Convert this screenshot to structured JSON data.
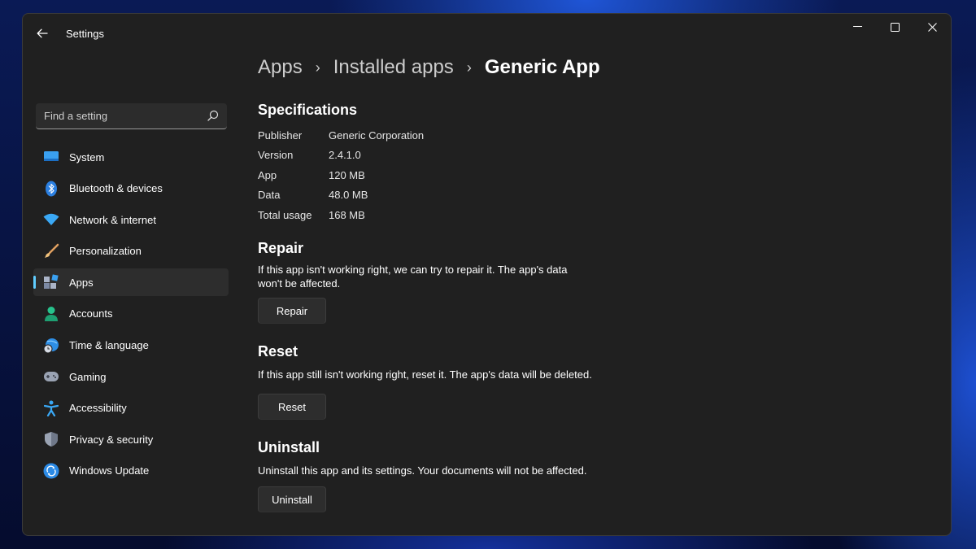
{
  "window": {
    "title": "Settings",
    "controls": {
      "minimize": "minimize-icon",
      "maximize": "maximize-icon",
      "close": "close-icon"
    }
  },
  "search": {
    "placeholder": "Find a setting",
    "icon": "search-icon"
  },
  "sidebar": {
    "items": [
      {
        "label": "System",
        "icon": "monitor-icon",
        "active": false
      },
      {
        "label": "Bluetooth & devices",
        "icon": "bluetooth-icon",
        "active": false
      },
      {
        "label": "Network & internet",
        "icon": "wifi-icon",
        "active": false
      },
      {
        "label": "Personalization",
        "icon": "brush-icon",
        "active": false
      },
      {
        "label": "Apps",
        "icon": "apps-icon",
        "active": true
      },
      {
        "label": "Accounts",
        "icon": "person-icon",
        "active": false
      },
      {
        "label": "Time & language",
        "icon": "globe-clock-icon",
        "active": false
      },
      {
        "label": "Gaming",
        "icon": "gamepad-icon",
        "active": false
      },
      {
        "label": "Accessibility",
        "icon": "accessibility-icon",
        "active": false
      },
      {
        "label": "Privacy & security",
        "icon": "shield-icon",
        "active": false
      },
      {
        "label": "Windows Update",
        "icon": "update-icon",
        "active": false
      }
    ]
  },
  "breadcrumb": [
    "Apps",
    "Installed apps",
    "Generic App"
  ],
  "specifications": {
    "title": "Specifications",
    "rows": [
      {
        "key": "Publisher",
        "value": "Generic Corporation"
      },
      {
        "key": "Version",
        "value": "2.4.1.0"
      },
      {
        "key": "App",
        "value": "120 MB"
      },
      {
        "key": "Data",
        "value": "48.0 MB"
      },
      {
        "key": "Total usage",
        "value": "168 MB"
      }
    ]
  },
  "repair": {
    "title": "Repair",
    "description": "If this app isn't working right, we can try to repair it. The app's data won't be affected.",
    "button": "Repair"
  },
  "reset": {
    "title": "Reset",
    "description": "If this app still isn't working right, reset it. The app's data will be deleted.",
    "button": "Reset"
  },
  "uninstall": {
    "title": "Uninstall",
    "description": "Uninstall this app and its settings. Your documents will not be affected.",
    "button": "Uninstall"
  },
  "colors": {
    "accent": "#60cdff",
    "window_bg": "#202020",
    "selected_bg": "#2d2d2d"
  }
}
